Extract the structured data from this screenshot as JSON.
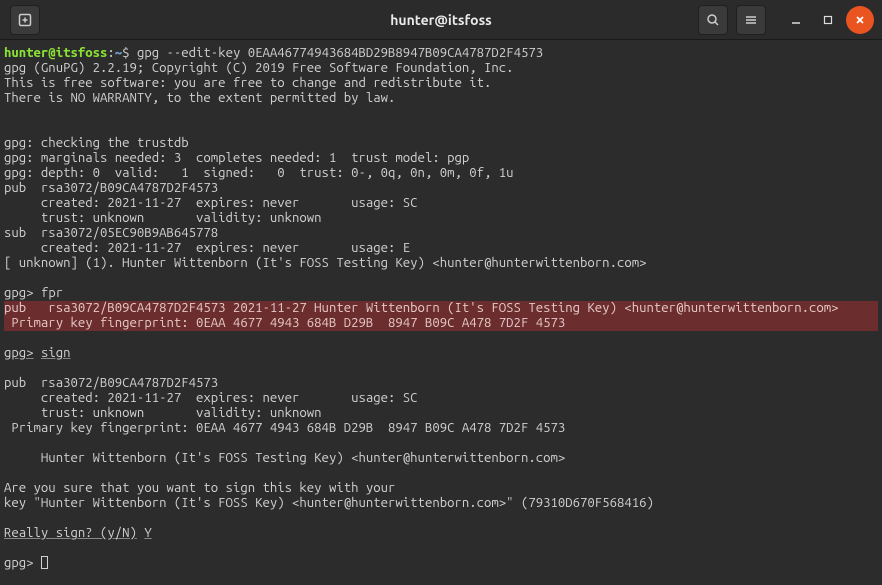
{
  "titlebar": {
    "title": "hunter@itsfoss"
  },
  "prompt": {
    "user_host": "hunter@itsfoss",
    "path": "~",
    "sep": ":",
    "dollar": "$",
    "cmd": "gpg --edit-key 0EAA46774943684BD29B8947B09CA4787D2F4573"
  },
  "gpg": {
    "version": "gpg (GnuPG) 2.2.19; Copyright (C) 2019 Free Software Foundation, Inc.",
    "license1": "This is free software: you are free to change and redistribute it.",
    "license2": "There is NO WARRANTY, to the extent permitted by law.",
    "trustdb": "gpg: checking the trustdb",
    "marginals": "gpg: marginals needed: 3  completes needed: 1  trust model: pgp",
    "depth": "gpg: depth: 0  valid:   1  signed:   0  trust: 0-, 0q, 0n, 0m, 0f, 1u",
    "pub1": "pub  rsa3072/B09CA4787D2F4573",
    "pub1_created": "     created: 2021-11-27  expires: never       usage: SC  ",
    "pub1_trust": "     trust: unknown       validity: unknown",
    "sub1": "sub  rsa3072/05EC90B9AB645778",
    "sub1_created": "     created: 2021-11-27  expires: never       usage: E   ",
    "uid": "[ unknown] (1). Hunter Wittenborn (It's FOSS Testing Key) <hunter@hunterwittenborn.com>",
    "prompt": "gpg>",
    "cmd_fpr": "fpr",
    "hl_pub": "pub   rsa3072/B09CA4787D2F4573 2021-11-27 Hunter Wittenborn (It's FOSS Testing Key) <hunter@hunterwittenborn.com>",
    "hl_fp": " Primary key fingerprint: 0EAA 4677 4943 684B D29B  8947 B09C A478 7D2F 4573",
    "cmd_sign": "sign",
    "pub2": "pub  rsa3072/B09CA4787D2F4573",
    "pub2_created": "     created: 2021-11-27  expires: never       usage: SC  ",
    "pub2_trust": "     trust: unknown       validity: unknown",
    "fp2": " Primary key fingerprint: 0EAA 4677 4943 684B D29B  8947 B09C A478 7D2F 4573",
    "uid2": "     Hunter Wittenborn (It's FOSS Testing Key) <hunter@hunterwittenborn.com>",
    "confirm1": "Are you sure that you want to sign this key with your",
    "confirm2": "key \"Hunter Wittenborn (It's FOSS Key) <hunter@hunterwittenborn.com>\" (79310D670F568416)",
    "really_sign": "Really sign? (y/N)",
    "answer": "Y"
  }
}
